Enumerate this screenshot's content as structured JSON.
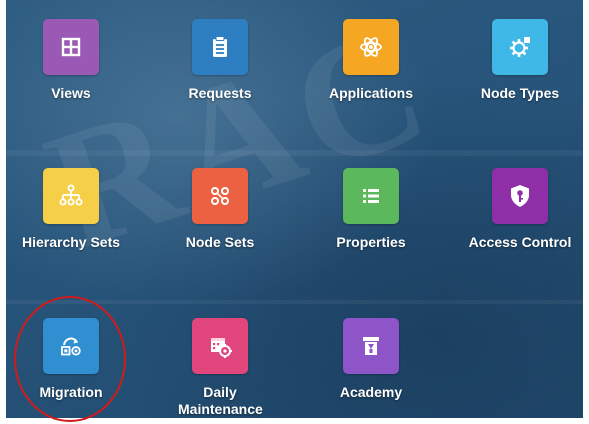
{
  "tiles": [
    {
      "label": "Views",
      "icon": "grid-icon",
      "color": "#9b59b6"
    },
    {
      "label": "Requests",
      "icon": "clipboard-icon",
      "color": "#2d7fc1"
    },
    {
      "label": "Applications",
      "icon": "atom-icon",
      "color": "#f5a623"
    },
    {
      "label": "Node Types",
      "icon": "gear-node-icon",
      "color": "#3fb8e8"
    },
    {
      "label": "Hierarchy Sets",
      "icon": "hierarchy-icon",
      "color": "#f5cf47"
    },
    {
      "label": "Node Sets",
      "icon": "nodes-icon",
      "color": "#ec6142"
    },
    {
      "label": "Properties",
      "icon": "list-icon",
      "color": "#5cb85c"
    },
    {
      "label": "Access Control",
      "icon": "shield-key-icon",
      "color": "#8f2fa8"
    },
    {
      "label": "Migration",
      "icon": "migration-icon",
      "color": "#2f8fd0"
    },
    {
      "label": "Daily Maintenance",
      "icon": "calendar-gear-icon",
      "color": "#e0457b"
    },
    {
      "label": "Academy",
      "icon": "academy-icon",
      "color": "#8e55c8"
    }
  ],
  "annotation": {
    "color": "#d31a1a",
    "target": "Migration"
  }
}
